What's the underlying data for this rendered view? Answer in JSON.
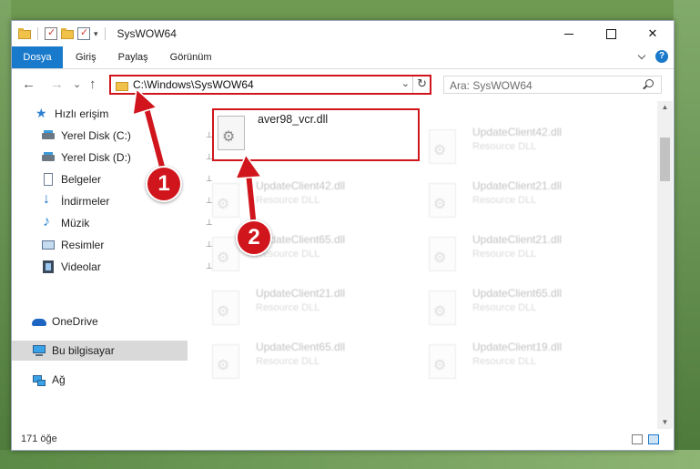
{
  "window": {
    "title": "SysWOW64",
    "controls": {
      "minimize": "",
      "maximize": "",
      "close": "✕"
    }
  },
  "ribbon": {
    "tabs": [
      "Dosya",
      "Giriş",
      "Paylaş",
      "Görünüm"
    ],
    "help": "?"
  },
  "address": {
    "path": "C:\\Windows\\SysWOW64",
    "dropdown": "⌄",
    "refresh": "↻"
  },
  "search": {
    "placeholder": "Ara: SysWOW64"
  },
  "nav_buttons": {
    "back": "←",
    "forward": "→",
    "recent": "⌄",
    "up": "↑"
  },
  "sidebar": {
    "items": [
      {
        "label": "Hızlı erişim",
        "icon": "star-icon",
        "pinned": false
      },
      {
        "label": "Yerel Disk (C:)",
        "icon": "disk-icon",
        "pinned": true
      },
      {
        "label": "Yerel Disk (D:)",
        "icon": "disk-icon",
        "pinned": true
      },
      {
        "label": "Belgeler",
        "icon": "documents-icon",
        "pinned": true
      },
      {
        "label": "İndirmeler",
        "icon": "downloads-icon",
        "pinned": true
      },
      {
        "label": "Müzik",
        "icon": "music-icon",
        "pinned": true
      },
      {
        "label": "Resimler",
        "icon": "pictures-icon",
        "pinned": true
      },
      {
        "label": "Videolar",
        "icon": "videos-icon",
        "pinned": true
      },
      {
        "label": "OneDrive",
        "icon": "onedrive-icon",
        "pinned": false
      },
      {
        "label": "Bu bilgisayar",
        "icon": "this-pc-icon",
        "pinned": false
      },
      {
        "label": "Ağ",
        "icon": "network-icon",
        "pinned": false
      }
    ],
    "pin_glyph": "📌"
  },
  "files": {
    "highlighted": {
      "name": "aver98_vcr.dll"
    },
    "left_column": [
      {
        "name": "UpdateClient42.dll",
        "type": "Resource DLL"
      },
      {
        "name": "UpdateClient65.dll",
        "type": "Resource DLL"
      },
      {
        "name": "UpdateClient21.dll",
        "type": "Resource DLL"
      },
      {
        "name": "UpdateClient65.dll",
        "type": "Resource DLL"
      }
    ],
    "right_column": [
      {
        "name": "UpdateClient42.dll",
        "type": "Resource DLL"
      },
      {
        "name": "UpdateClient21.dll",
        "type": "Resource DLL"
      },
      {
        "name": "UpdateClient21.dll",
        "type": "Resource DLL"
      },
      {
        "name": "UpdateClient65.dll",
        "type": "Resource DLL"
      },
      {
        "name": "UpdateClient19.dll",
        "type": "Resource DLL"
      }
    ]
  },
  "status": {
    "item_count": "171 öğe"
  },
  "annotations": {
    "callout_1": "1",
    "callout_2": "2",
    "color": "#d0161c"
  }
}
